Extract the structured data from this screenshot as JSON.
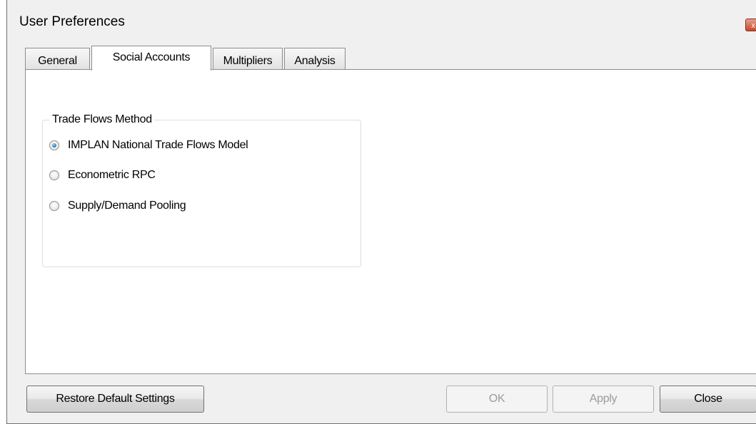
{
  "window": {
    "title": "User Preferences",
    "close_glyph": "x"
  },
  "tabs": [
    {
      "label": "General",
      "active": false
    },
    {
      "label": "Social Accounts",
      "active": true
    },
    {
      "label": "Multipliers",
      "active": false
    },
    {
      "label": "Analysis",
      "active": false
    }
  ],
  "trade_flows": {
    "legend": "Trade Flows Method",
    "options": [
      {
        "label": "IMPLAN National Trade Flows Model",
        "checked": true
      },
      {
        "label": "Econometric RPC",
        "checked": false
      },
      {
        "label": "Supply/Demand Pooling",
        "checked": false
      }
    ]
  },
  "buttons": {
    "restore": "Restore Default Settings",
    "ok": "OK",
    "apply": "Apply",
    "close": "Close"
  },
  "colors": {
    "window_bg": "#f0f0f0",
    "panel_bg": "#ffffff",
    "radio_accent": "#1f6fb5",
    "close_button": "#c24a2d"
  },
  "icons": {
    "close": "close-icon",
    "radio_selected": "radio-checked-icon",
    "radio_unselected": "radio-unchecked-icon"
  }
}
